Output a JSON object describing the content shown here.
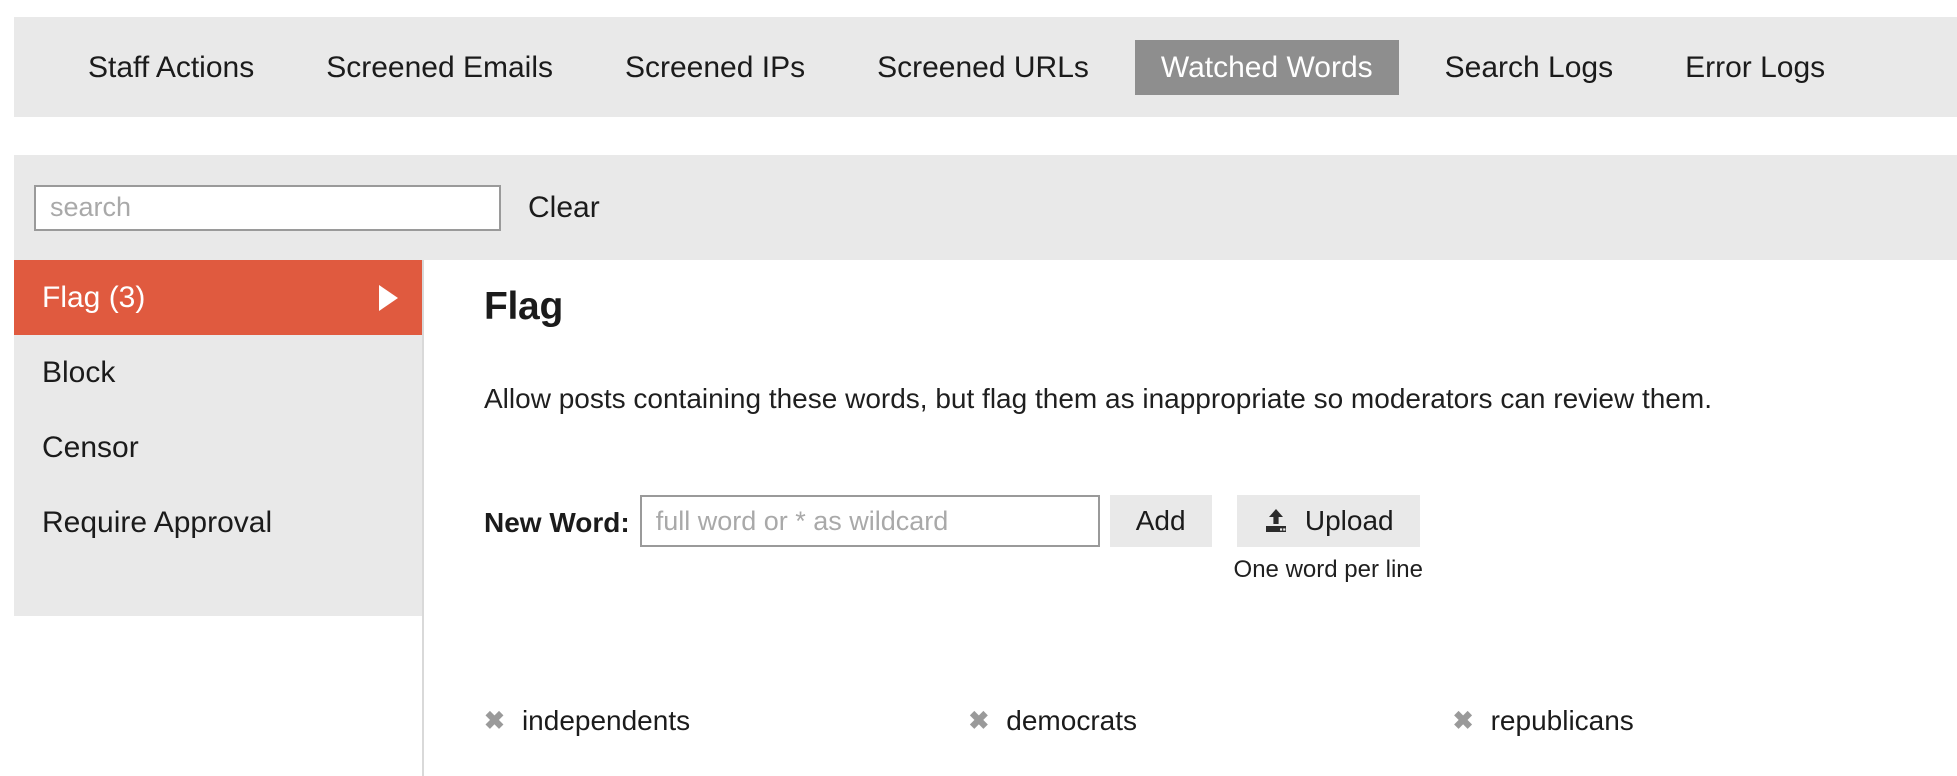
{
  "tabs": [
    {
      "label": "Staff Actions",
      "active": false
    },
    {
      "label": "Screened Emails",
      "active": false
    },
    {
      "label": "Screened IPs",
      "active": false
    },
    {
      "label": "Screened URLs",
      "active": false
    },
    {
      "label": "Watched Words",
      "active": true
    },
    {
      "label": "Search Logs",
      "active": false
    },
    {
      "label": "Error Logs",
      "active": false
    }
  ],
  "search": {
    "value": "",
    "placeholder": "search",
    "clear_label": "Clear"
  },
  "sidebar": {
    "items": [
      {
        "label": "Flag (3)",
        "active": true
      },
      {
        "label": "Block",
        "active": false
      },
      {
        "label": "Censor",
        "active": false
      },
      {
        "label": "Require Approval",
        "active": false
      }
    ]
  },
  "main": {
    "title": "Flag",
    "description": "Allow posts containing these words, but flag them as inappropriate so moderators can review them.",
    "form": {
      "new_word_label": "New Word:",
      "new_word_value": "",
      "new_word_placeholder": "full word or * as wildcard",
      "add_label": "Add",
      "upload_label": "Upload",
      "upload_hint": "One word per line"
    },
    "words": [
      {
        "text": "independents"
      },
      {
        "text": "democrats"
      },
      {
        "text": "republicans"
      }
    ]
  },
  "colors": {
    "accent": "#e05a3f",
    "panel": "#e9e9e9",
    "active_tab": "#8e8e8e"
  }
}
